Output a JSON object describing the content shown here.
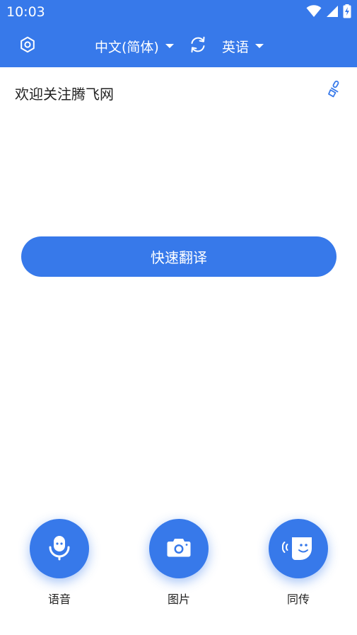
{
  "status_bar": {
    "time": "10:03",
    "icons": [
      "wifi-icon",
      "cell-signal-icon",
      "battery-charging-icon"
    ]
  },
  "toolbar": {
    "settings_icon": "settings-icon",
    "source_language": "中文(简体)",
    "swap_icon": "swap-languages-icon",
    "target_language": "英语"
  },
  "input": {
    "text": "欢迎关注腾飞网",
    "clear_icon": "brush-clear-icon"
  },
  "translate_button": {
    "label": "快速翻译"
  },
  "features": [
    {
      "label": "语音",
      "icon": "microphone-icon"
    },
    {
      "label": "图片",
      "icon": "camera-icon"
    },
    {
      "label": "同传",
      "icon": "simultaneous-interpretation-icon"
    }
  ],
  "colors": {
    "primary": "#3779ea",
    "background": "#ffffff",
    "text": "#222222"
  }
}
